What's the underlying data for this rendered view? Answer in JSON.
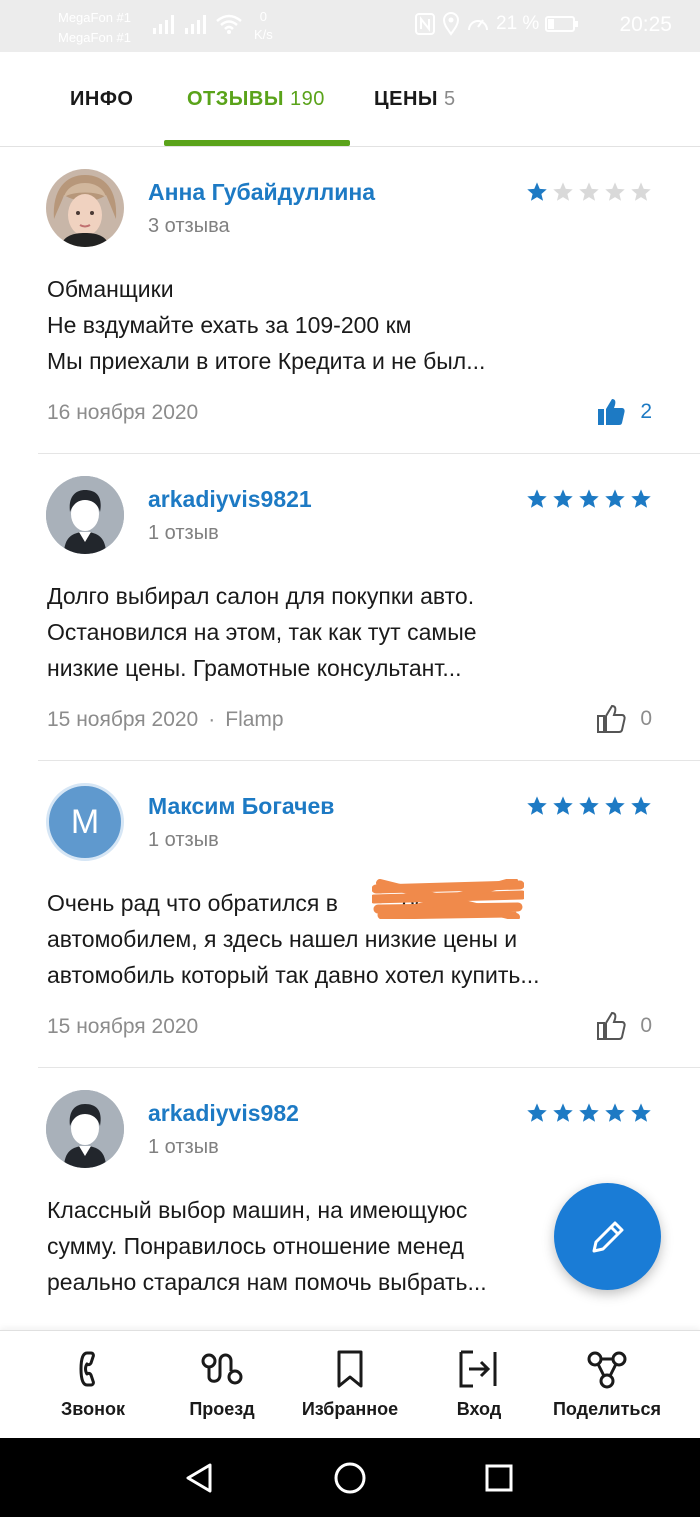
{
  "status_bar": {
    "carrier_1": "MegaFon #1",
    "carrier_2": "MegaFon #1",
    "net_speed_value": "0",
    "net_speed_unit": "K/s",
    "battery": "21 %",
    "time": "20:25"
  },
  "tabs": [
    {
      "label": "ИНФО",
      "count": ""
    },
    {
      "label": "ОТЗЫВЫ",
      "count": "190"
    },
    {
      "label": "ЦЕНЫ",
      "count": "5"
    }
  ],
  "colors": {
    "accent_green": "#5aa31a",
    "link_blue": "#1d7ac4",
    "star_filled": "#1d7ac4",
    "star_empty": "#d9d9d9",
    "fab": "#1a7cd6",
    "redaction": "#f08a4b"
  },
  "reviews": [
    {
      "author": "Анна Губайдуллина",
      "review_count": "3 отзыва",
      "rating": 1,
      "text_line1": "Обманщики",
      "text_line2": "Не вздумайте ехать за 109-200 км",
      "text_line3": "Мы приехали в итоге Кредита и не был...",
      "date": "16 ноября 2020",
      "source": "",
      "likes": "2",
      "liked": true,
      "avatar": "photo"
    },
    {
      "author": "arkadiyvis9821",
      "review_count": "1 отзыв",
      "rating": 5,
      "text_line1": "Долго выбирал салон для покупки авто.",
      "text_line2": "Остановился на этом, так как тут самые",
      "text_line3": "низкие цены. Грамотные консультант...",
      "date": "15 ноября 2020",
      "source": "Flamp",
      "likes": "0",
      "liked": false,
      "avatar": "default-user"
    },
    {
      "author": "Максим Богачев",
      "review_count": "1 отзыв",
      "rating": 5,
      "text_line1": "Очень рад что обратился в          ос за",
      "text_line2": "автомобилем, я здесь нашел низкие цены и",
      "text_line3": "автомобиль который так давно хотел купить...",
      "date": "15 ноября 2020",
      "source": "",
      "likes": "0",
      "liked": false,
      "avatar": "letter",
      "avatar_letter": "М"
    },
    {
      "author": "arkadiyvis982",
      "review_count": "1 отзыв",
      "rating": 5,
      "text_line1": "Классный выбор машин, на имеющуюс",
      "text_line2": "сумму. Понравилось отношение менед",
      "text_line3": "реально старался нам помочь выбрать...",
      "date": "",
      "source": "",
      "likes": "",
      "liked": false,
      "avatar": "default-user"
    }
  ],
  "bottom_bar": [
    {
      "label": "Звонок",
      "icon": "phone-icon"
    },
    {
      "label": "Проезд",
      "icon": "route-icon"
    },
    {
      "label": "Избранное",
      "icon": "bookmark-icon"
    },
    {
      "label": "Вход",
      "icon": "entrance-icon"
    },
    {
      "label": "Поделиться",
      "icon": "share-icon"
    }
  ],
  "fab": {
    "icon": "pencil-icon"
  },
  "system_nav": [
    "back-icon",
    "home-icon",
    "recents-icon"
  ]
}
